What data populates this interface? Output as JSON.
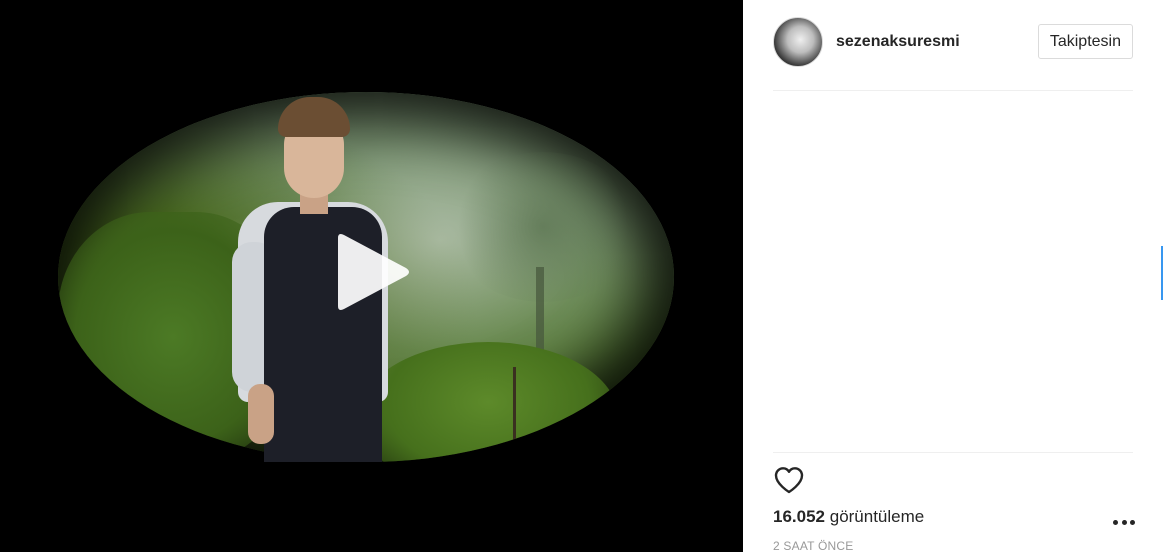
{
  "post": {
    "username": "sezenaksuresmi",
    "follow_label": "Takiptesin",
    "views_count": "16.052",
    "views_label": "görüntüleme",
    "time_ago": "2 SAAT ÖNCE"
  },
  "icons": {
    "play": "play-icon",
    "heart": "heart-icon",
    "more": "more-options-icon",
    "avatar": "avatar"
  },
  "colors": {
    "background": "#ffffff",
    "media_background": "#000000",
    "text": "#262626",
    "muted": "#999999",
    "border": "#dbdbdb"
  }
}
